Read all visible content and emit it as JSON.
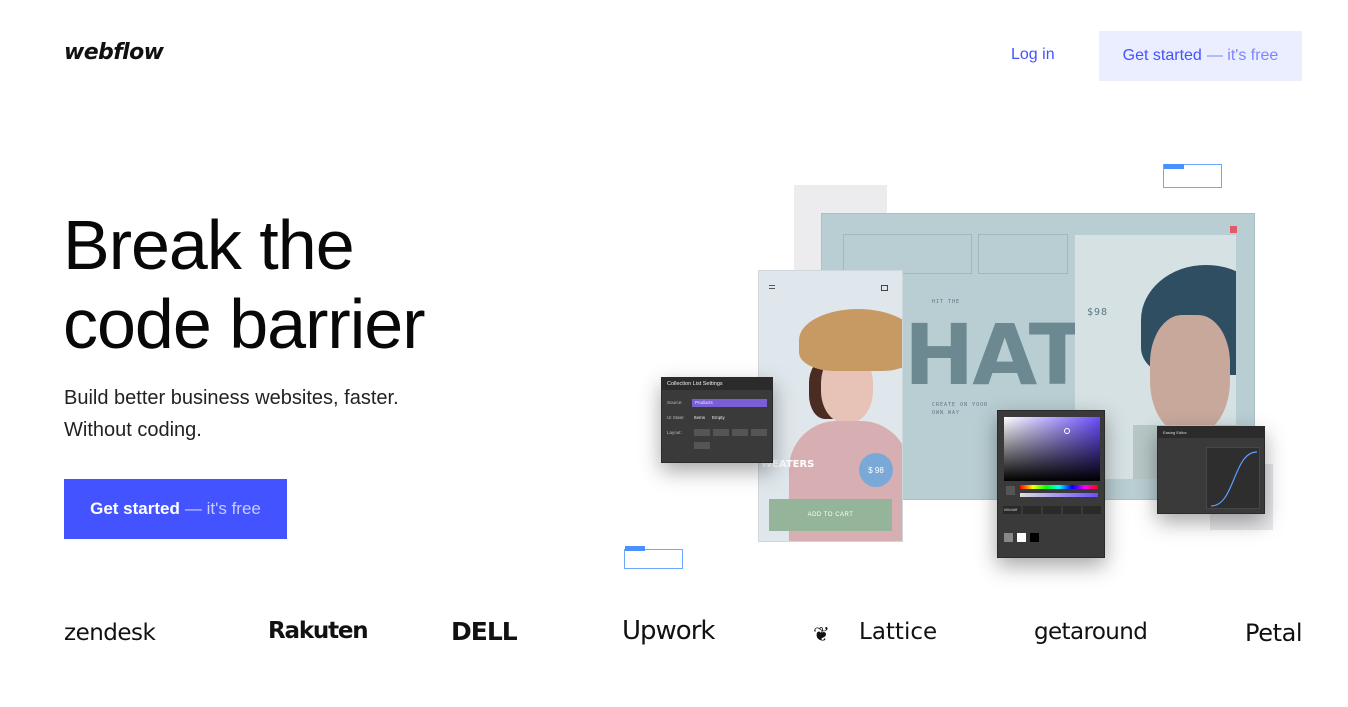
{
  "nav": {
    "logo": "webflow",
    "login": "Log in",
    "cta_main": "Get started",
    "cta_suffix": "— it's free"
  },
  "hero": {
    "headline_line1": "Break the",
    "headline_line2": "code barrier",
    "sub_line1": "Build better business websites, faster.",
    "sub_line2": "Without coding.",
    "cta_main": "Get started",
    "cta_suffix": "— it's free"
  },
  "collage": {
    "hats_text": "HATS",
    "sweaters_text": "WEATERS",
    "price_text": "$ 98",
    "add_to_cart": "ADD TO CART",
    "collection_title": "Collection List Settings",
    "collection_source_label": "Source:",
    "collection_source_value": "Products",
    "collection_state_label": "UI State:",
    "collection_state_items": "Items",
    "collection_state_empty": "Empty",
    "collection_layout_label": "Layout:",
    "picker_hex": "#6b4dff",
    "easing_title": "Easing Editor"
  },
  "logos": [
    "zendesk",
    "Rakuten",
    "DELL",
    "Upwork",
    "Lattice",
    "getaround",
    "Petal"
  ],
  "colors": {
    "accent": "#4353ff",
    "accent_light": "#ebeeff",
    "text": "#080808"
  }
}
